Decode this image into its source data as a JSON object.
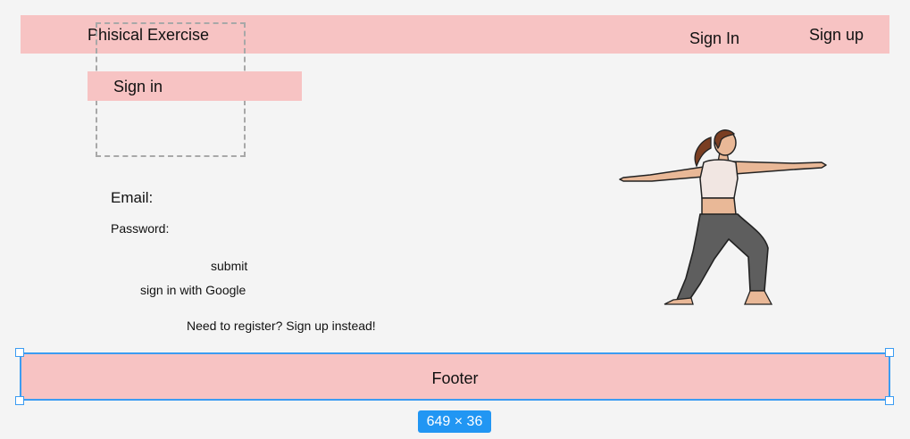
{
  "header": {
    "brand": "Phisical Exercise",
    "nav_sign_in": "Sign In",
    "nav_sign_up": "Sign up"
  },
  "main": {
    "heading": "Sign in",
    "email_label": "Email:",
    "password_label": "Password:",
    "submit_label": "submit",
    "google_label": "sign in with Google",
    "register_text": "Need  to register? Sign up instead!"
  },
  "illustration": {
    "icon": "yoga-warrior-pose-illustration"
  },
  "footer": {
    "label": "Footer"
  },
  "selection": {
    "dimensions": "649 × 36"
  },
  "colors": {
    "block_fill": "#f7c3c3",
    "selection_accent": "#2196f3",
    "canvas_bg": "#f4f4f4"
  }
}
